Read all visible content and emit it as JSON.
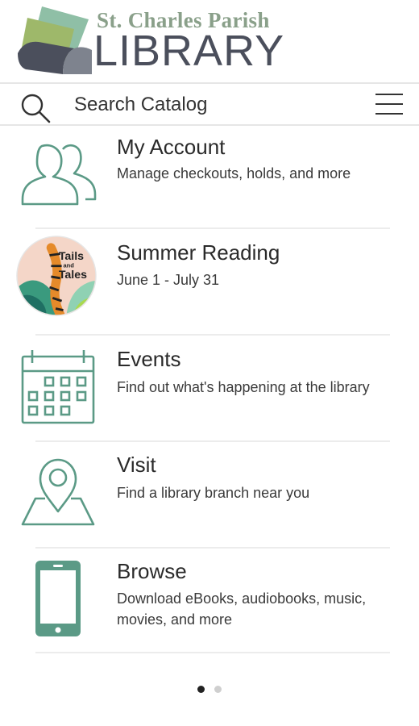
{
  "header": {
    "logo_line1": "St. Charles Parish",
    "logo_line2": "LIBRARY"
  },
  "search": {
    "placeholder": "Search Catalog",
    "icon": "search-icon",
    "menu_icon": "hamburger-menu-icon"
  },
  "menu": {
    "items": [
      {
        "title": "My Account",
        "subtitle": "Manage checkouts, holds, and more",
        "icon": "users-icon"
      },
      {
        "title": "Summer Reading",
        "subtitle": "June 1 - July 31",
        "icon": "summer-reading-badge",
        "badge_text": "Tails and Tales"
      },
      {
        "title": "Events",
        "subtitle": "Find out what's happening at the library",
        "icon": "calendar-icon"
      },
      {
        "title": "Visit",
        "subtitle": "Find a library branch near you",
        "icon": "map-pin-icon"
      },
      {
        "title": "Browse",
        "subtitle": "Download eBooks, audiobooks, music, movies, and more",
        "icon": "phone-icon"
      }
    ]
  },
  "pager": {
    "current_page": 1,
    "total_pages": 2
  },
  "colors": {
    "accent": "#5b9a86",
    "logo_green": "#8aa08a",
    "logo_gray": "#4b4f5c",
    "divider": "#ececec"
  }
}
